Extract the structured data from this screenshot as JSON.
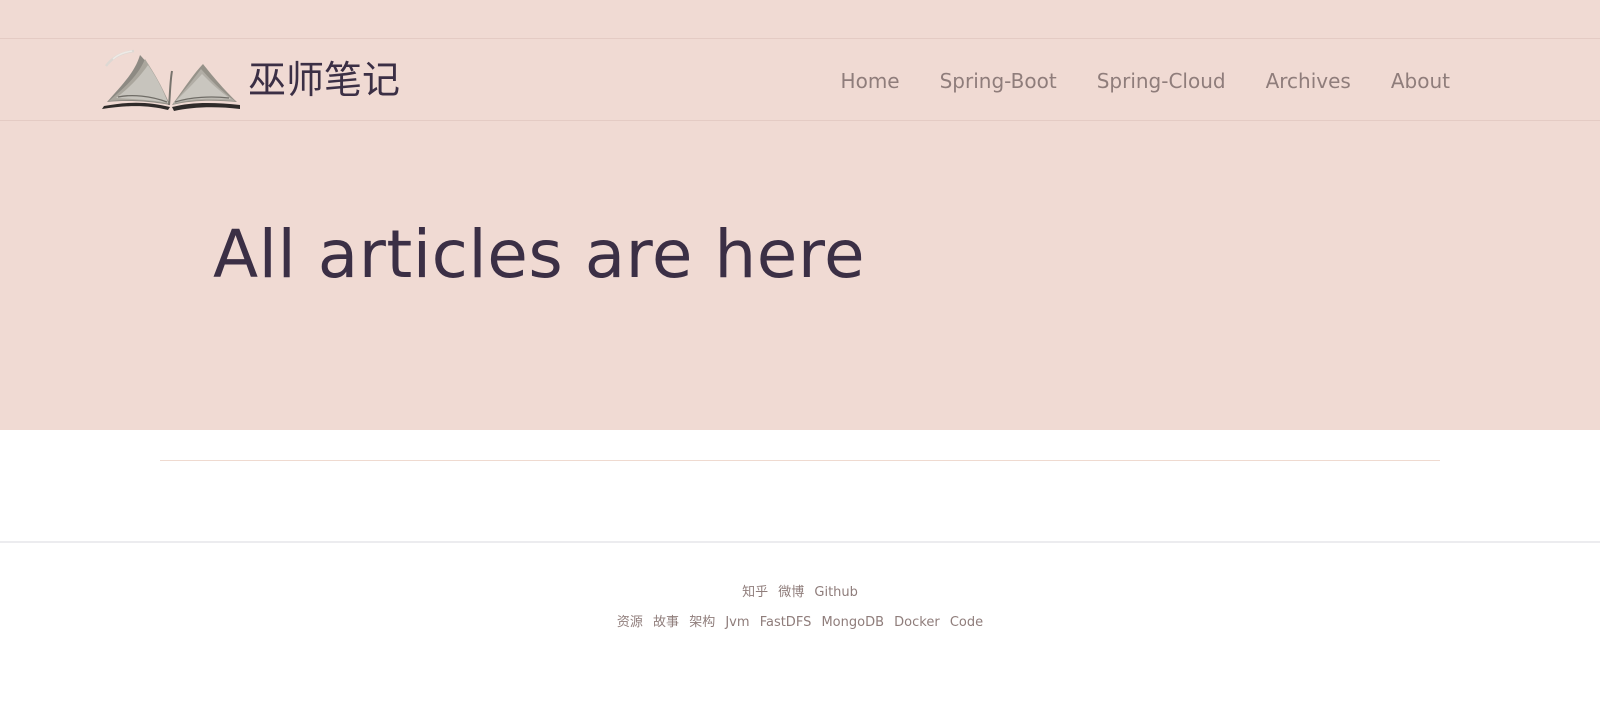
{
  "header": {
    "logo_icon": "open-book-icon",
    "site_title": "巫师笔记",
    "nav": [
      {
        "label": "Home"
      },
      {
        "label": "Spring-Boot"
      },
      {
        "label": "Spring-Cloud"
      },
      {
        "label": "Archives"
      },
      {
        "label": "About"
      }
    ]
  },
  "hero": {
    "title": "All articles are here"
  },
  "footer": {
    "social_links": [
      {
        "label": "知乎"
      },
      {
        "label": "微博"
      },
      {
        "label": "Github"
      }
    ],
    "topic_links": [
      {
        "label": "资源"
      },
      {
        "label": "故事"
      },
      {
        "label": "架构"
      },
      {
        "label": "Jvm"
      },
      {
        "label": "FastDFS"
      },
      {
        "label": "MongoDB"
      },
      {
        "label": "Docker"
      },
      {
        "label": "Code"
      }
    ]
  },
  "colors": {
    "header_background": "#f0dad3",
    "title_text": "#3b2f45",
    "nav_text": "#8f7d7b",
    "footer_text": "#8f7d7b",
    "divider": "#efdad0"
  }
}
